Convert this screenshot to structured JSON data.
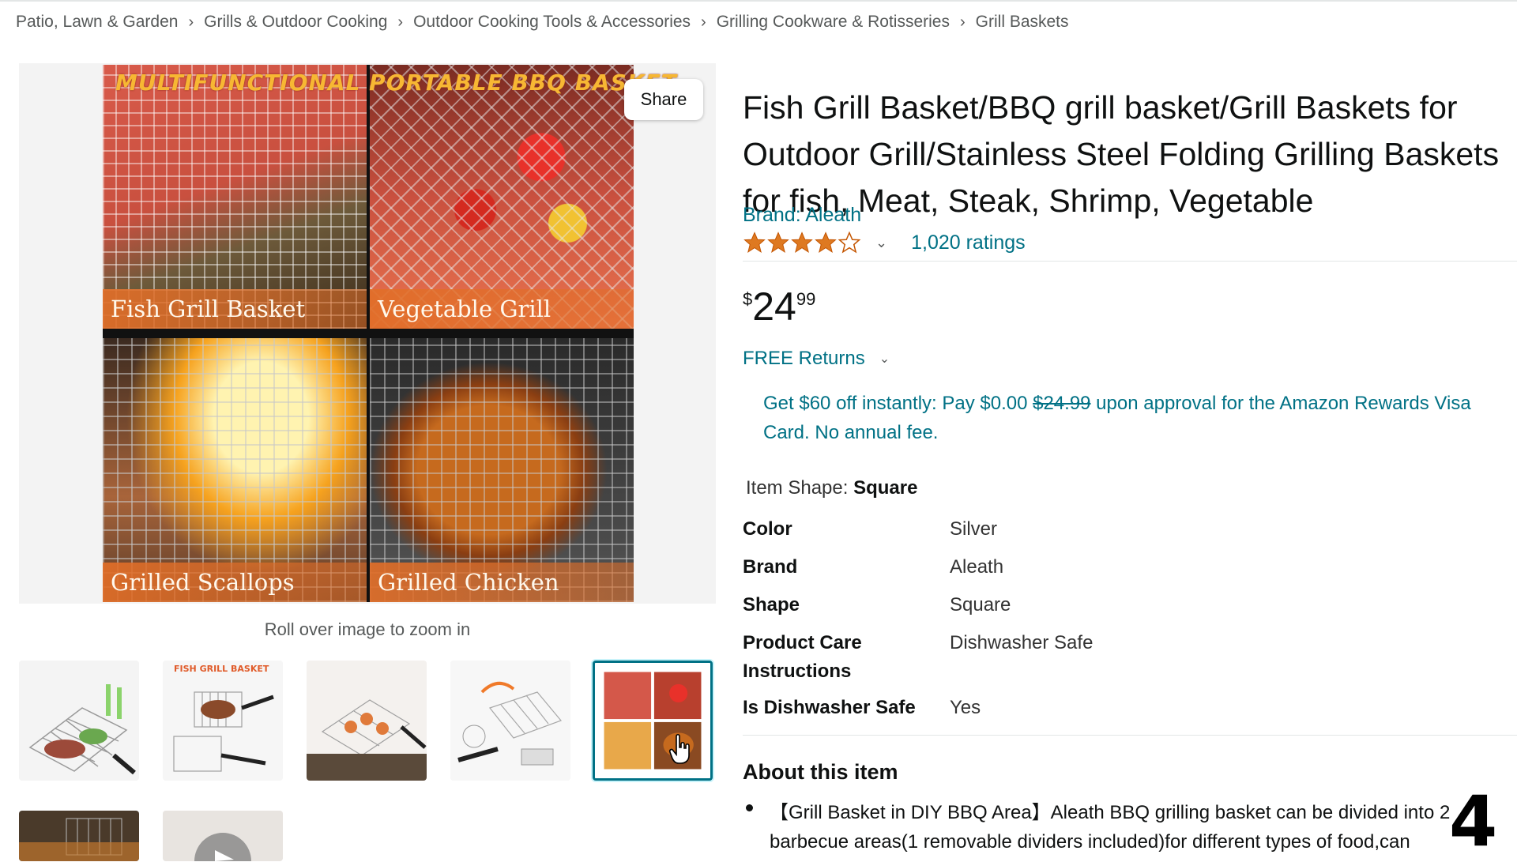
{
  "breadcrumb": [
    "Patio, Lawn & Garden",
    "Grills & Outdoor Cooking",
    "Outdoor Cooking Tools & Accessories",
    "Grilling Cookware & Rotisseries",
    "Grill Baskets"
  ],
  "gallery": {
    "banner": "MULTIFUNCTIONAL PORTABLE BBQ BASKET",
    "captions": [
      "Fish Grill Basket",
      "Vegetable Grill Basket",
      "Grilled Scallops",
      "Grilled Chicken"
    ],
    "share_label": "Share",
    "zoom_hint": "Roll over image to zoom in",
    "thumb_titles": [
      "FISH GRILL BASKET"
    ]
  },
  "product": {
    "title": "Fish Grill Basket/BBQ grill basket/Grill Baskets for Outdoor Grill/Stainless Steel Folding Grilling Baskets for fish, Meat, Steak, Shrimp, Vegetable",
    "brand_link": "Brand: Aleath",
    "rating_stars": 4,
    "ratings_count": "1,020 ratings",
    "price_symbol": "$",
    "price_whole": "24",
    "price_fraction": "99",
    "returns": "FREE Returns",
    "promo_before": "Get $60 off instantly: Pay $0.00 ",
    "promo_struck": "$24.99",
    "promo_after": " upon approval for the Amazon Rewards Visa Card. No annual fee.",
    "item_shape_label": "Item Shape:",
    "item_shape_value": "Square"
  },
  "specs": [
    {
      "key": "Color",
      "value": "Silver"
    },
    {
      "key": "Brand",
      "value": "Aleath"
    },
    {
      "key": "Shape",
      "value": "Square"
    },
    {
      "key": "Product Care Instructions",
      "value": "Dishwasher Safe"
    },
    {
      "key": "Is Dishwasher Safe",
      "value": "Yes"
    }
  ],
  "about": {
    "title": "About this item",
    "bullet1": "【Grill Basket in DIY BBQ Area】Aleath BBQ grilling basket can be divided into 2 barbecue areas(1 removable dividers included)for different types of food,can"
  },
  "overlay_step": "4",
  "colors": {
    "link": "#007185",
    "selected_thumb": "#007185",
    "star": "#de7921"
  }
}
